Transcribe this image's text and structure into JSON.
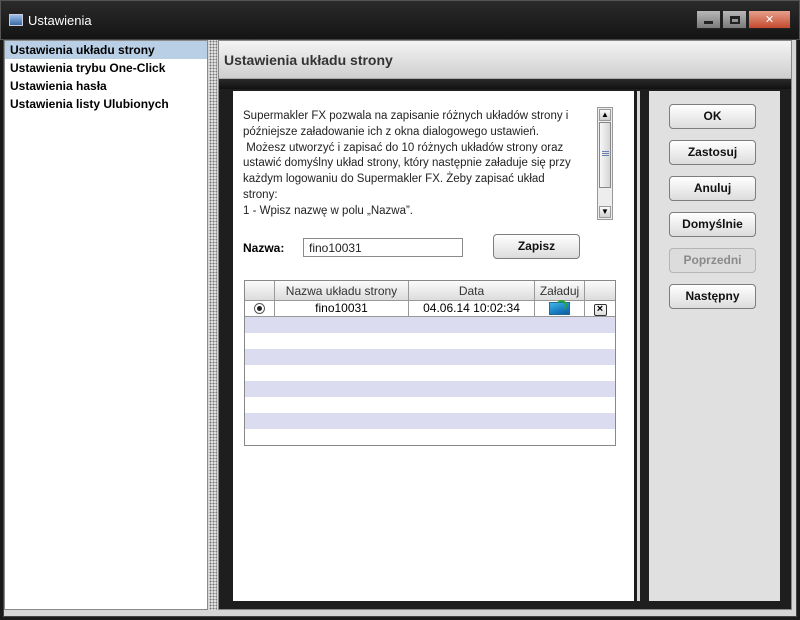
{
  "window": {
    "title": "Ustawienia"
  },
  "sidebar": {
    "items": [
      {
        "label": "Ustawienia układu strony",
        "selected": true
      },
      {
        "label": "Ustawienia trybu One-Click",
        "selected": false
      },
      {
        "label": "Ustawienia hasła",
        "selected": false
      },
      {
        "label": "Ustawienia listy Ulubionych",
        "selected": false
      }
    ]
  },
  "panel": {
    "title": "Ustawienia układu strony",
    "description_lines": [
      "Supermakler FX pozwala na zapisanie różnych układów strony i",
      "późniejsze załadowanie ich z okna dialogowego ustawień.",
      " Możesz utworzyć i zapisać do 10 różnych układów strony oraz",
      "ustawić domyślny układ strony, który następnie załaduje się przy",
      "każdym logowaniu do Supermakler FX. Żeby zapisać układ",
      "strony:",
      "1 - Wpisz nazwę w polu „Nazwa”."
    ],
    "name_label": "Nazwa:",
    "name_value": "fino10031",
    "save_button": "Zapisz",
    "table": {
      "headers": [
        "",
        "Nazwa układu strony",
        "Data",
        "Załaduj",
        ""
      ],
      "rows": [
        {
          "selected": true,
          "name": "fino10031",
          "date": "04.06.14 10:02:34"
        }
      ]
    }
  },
  "buttons": {
    "ok": "OK",
    "apply": "Zastosuj",
    "cancel": "Anuluj",
    "defaults": "Domyślnie",
    "previous": "Poprzedni",
    "next": "Następny"
  },
  "icons": {
    "window": "window-app-icon",
    "minimize": "minimize-icon",
    "maximize": "maximize-icon",
    "close": "close-icon",
    "load": "load-layout-icon",
    "delete": "delete-icon"
  }
}
